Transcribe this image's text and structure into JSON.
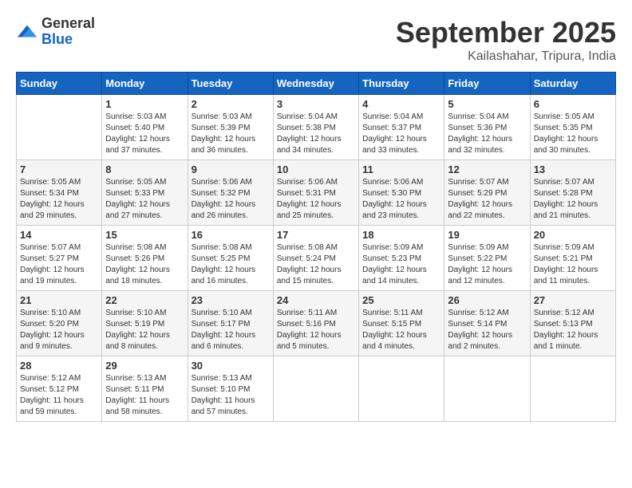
{
  "header": {
    "logo_general": "General",
    "logo_blue": "Blue",
    "month_title": "September 2025",
    "subtitle": "Kailashahar, Tripura, India"
  },
  "calendar": {
    "days_of_week": [
      "Sunday",
      "Monday",
      "Tuesday",
      "Wednesday",
      "Thursday",
      "Friday",
      "Saturday"
    ],
    "weeks": [
      [
        {
          "day": "",
          "info": ""
        },
        {
          "day": "1",
          "info": "Sunrise: 5:03 AM\nSunset: 5:40 PM\nDaylight: 12 hours\nand 37 minutes."
        },
        {
          "day": "2",
          "info": "Sunrise: 5:03 AM\nSunset: 5:39 PM\nDaylight: 12 hours\nand 36 minutes."
        },
        {
          "day": "3",
          "info": "Sunrise: 5:04 AM\nSunset: 5:38 PM\nDaylight: 12 hours\nand 34 minutes."
        },
        {
          "day": "4",
          "info": "Sunrise: 5:04 AM\nSunset: 5:37 PM\nDaylight: 12 hours\nand 33 minutes."
        },
        {
          "day": "5",
          "info": "Sunrise: 5:04 AM\nSunset: 5:36 PM\nDaylight: 12 hours\nand 32 minutes."
        },
        {
          "day": "6",
          "info": "Sunrise: 5:05 AM\nSunset: 5:35 PM\nDaylight: 12 hours\nand 30 minutes."
        }
      ],
      [
        {
          "day": "7",
          "info": "Sunrise: 5:05 AM\nSunset: 5:34 PM\nDaylight: 12 hours\nand 29 minutes."
        },
        {
          "day": "8",
          "info": "Sunrise: 5:05 AM\nSunset: 5:33 PM\nDaylight: 12 hours\nand 27 minutes."
        },
        {
          "day": "9",
          "info": "Sunrise: 5:06 AM\nSunset: 5:32 PM\nDaylight: 12 hours\nand 26 minutes."
        },
        {
          "day": "10",
          "info": "Sunrise: 5:06 AM\nSunset: 5:31 PM\nDaylight: 12 hours\nand 25 minutes."
        },
        {
          "day": "11",
          "info": "Sunrise: 5:06 AM\nSunset: 5:30 PM\nDaylight: 12 hours\nand 23 minutes."
        },
        {
          "day": "12",
          "info": "Sunrise: 5:07 AM\nSunset: 5:29 PM\nDaylight: 12 hours\nand 22 minutes."
        },
        {
          "day": "13",
          "info": "Sunrise: 5:07 AM\nSunset: 5:28 PM\nDaylight: 12 hours\nand 21 minutes."
        }
      ],
      [
        {
          "day": "14",
          "info": "Sunrise: 5:07 AM\nSunset: 5:27 PM\nDaylight: 12 hours\nand 19 minutes."
        },
        {
          "day": "15",
          "info": "Sunrise: 5:08 AM\nSunset: 5:26 PM\nDaylight: 12 hours\nand 18 minutes."
        },
        {
          "day": "16",
          "info": "Sunrise: 5:08 AM\nSunset: 5:25 PM\nDaylight: 12 hours\nand 16 minutes."
        },
        {
          "day": "17",
          "info": "Sunrise: 5:08 AM\nSunset: 5:24 PM\nDaylight: 12 hours\nand 15 minutes."
        },
        {
          "day": "18",
          "info": "Sunrise: 5:09 AM\nSunset: 5:23 PM\nDaylight: 12 hours\nand 14 minutes."
        },
        {
          "day": "19",
          "info": "Sunrise: 5:09 AM\nSunset: 5:22 PM\nDaylight: 12 hours\nand 12 minutes."
        },
        {
          "day": "20",
          "info": "Sunrise: 5:09 AM\nSunset: 5:21 PM\nDaylight: 12 hours\nand 11 minutes."
        }
      ],
      [
        {
          "day": "21",
          "info": "Sunrise: 5:10 AM\nSunset: 5:20 PM\nDaylight: 12 hours\nand 9 minutes."
        },
        {
          "day": "22",
          "info": "Sunrise: 5:10 AM\nSunset: 5:19 PM\nDaylight: 12 hours\nand 8 minutes."
        },
        {
          "day": "23",
          "info": "Sunrise: 5:10 AM\nSunset: 5:17 PM\nDaylight: 12 hours\nand 6 minutes."
        },
        {
          "day": "24",
          "info": "Sunrise: 5:11 AM\nSunset: 5:16 PM\nDaylight: 12 hours\nand 5 minutes."
        },
        {
          "day": "25",
          "info": "Sunrise: 5:11 AM\nSunset: 5:15 PM\nDaylight: 12 hours\nand 4 minutes."
        },
        {
          "day": "26",
          "info": "Sunrise: 5:12 AM\nSunset: 5:14 PM\nDaylight: 12 hours\nand 2 minutes."
        },
        {
          "day": "27",
          "info": "Sunrise: 5:12 AM\nSunset: 5:13 PM\nDaylight: 12 hours\nand 1 minute."
        }
      ],
      [
        {
          "day": "28",
          "info": "Sunrise: 5:12 AM\nSunset: 5:12 PM\nDaylight: 11 hours\nand 59 minutes."
        },
        {
          "day": "29",
          "info": "Sunrise: 5:13 AM\nSunset: 5:11 PM\nDaylight: 11 hours\nand 58 minutes."
        },
        {
          "day": "30",
          "info": "Sunrise: 5:13 AM\nSunset: 5:10 PM\nDaylight: 11 hours\nand 57 minutes."
        },
        {
          "day": "",
          "info": ""
        },
        {
          "day": "",
          "info": ""
        },
        {
          "day": "",
          "info": ""
        },
        {
          "day": "",
          "info": ""
        }
      ]
    ]
  }
}
